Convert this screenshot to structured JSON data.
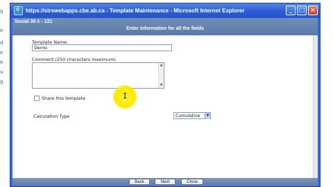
{
  "window": {
    "title": "https://sirswebapps.cbe.ab.ca - Template Maintenance - Microsoft Internet Explorer",
    "minimize_glyph": "_",
    "maximize_glyph": "□",
    "close_glyph": "×"
  },
  "header": {
    "course_label": "Social 30-1 - 121",
    "instruction": "Enter information for all the fields"
  },
  "form": {
    "template_name_label": "Template Name:",
    "template_name_value": "Demo",
    "comment_label": "Comment:(250 characters maximum)",
    "comment_value": "",
    "share_label": "Share this template",
    "share_checked": false,
    "calculation_type_label": "Calculation Type",
    "calculation_type_value": "Cumulative"
  },
  "buttons": {
    "back": "Back",
    "next": "Next",
    "close": "Close"
  },
  "background_fragments": [
    "g",
    "e",
    "d",
    "e",
    "e",
    "u",
    "g"
  ]
}
